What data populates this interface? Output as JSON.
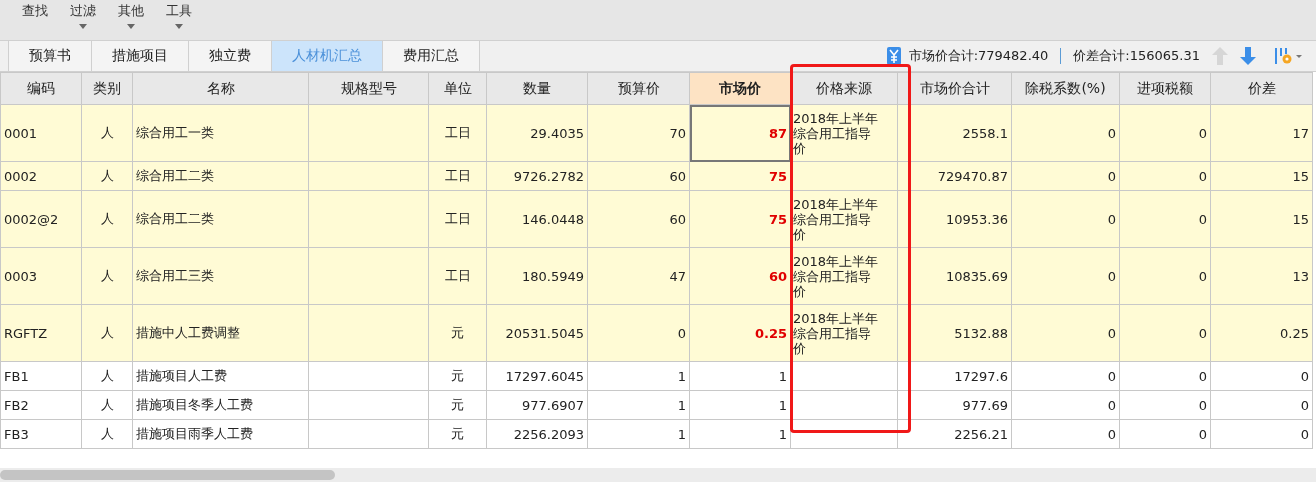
{
  "toolbar": [
    {
      "label": "查找",
      "has_menu": false
    },
    {
      "label": "过滤",
      "has_menu": true
    },
    {
      "label": "其他",
      "has_menu": true
    },
    {
      "label": "工具",
      "has_menu": true
    }
  ],
  "tabs": [
    {
      "label": "预算书",
      "selected": false
    },
    {
      "label": "措施项目",
      "selected": false
    },
    {
      "label": "独立费",
      "selected": false
    },
    {
      "label": "人材机汇总",
      "selected": true
    },
    {
      "label": "费用汇总",
      "selected": false
    }
  ],
  "summary": {
    "market_total": "市场价合计:779482.40",
    "diff_total": "价差合计:156065.31",
    "move_up_disabled": true,
    "move_down_disabled": false
  },
  "table": {
    "columns": [
      {
        "label": "编码",
        "kind": "text",
        "selected": false,
        "highlighted": false
      },
      {
        "label": "类别",
        "kind": "center",
        "selected": false,
        "highlighted": false
      },
      {
        "label": "名称",
        "kind": "text",
        "selected": false,
        "highlighted": false
      },
      {
        "label": "规格型号",
        "kind": "text",
        "selected": false,
        "highlighted": false
      },
      {
        "label": "单位",
        "kind": "center",
        "selected": false,
        "highlighted": false
      },
      {
        "label": "数量",
        "kind": "number",
        "selected": false,
        "highlighted": false
      },
      {
        "label": "预算价",
        "kind": "number",
        "selected": false,
        "highlighted": false
      },
      {
        "label": "市场价",
        "kind": "price",
        "selected": true,
        "highlighted": false
      },
      {
        "label": "价格来源",
        "kind": "wrap",
        "selected": false,
        "highlighted": true
      },
      {
        "label": "市场价合计",
        "kind": "number",
        "selected": false,
        "highlighted": false
      },
      {
        "label": "除税系数(%)",
        "kind": "number",
        "selected": false,
        "highlighted": false
      },
      {
        "label": "进项税额",
        "kind": "number",
        "selected": false,
        "highlighted": false
      },
      {
        "label": "价差",
        "kind": "number",
        "selected": false,
        "highlighted": false
      }
    ],
    "rows": [
      {
        "adjusted": true,
        "selected": true,
        "cells": [
          "0001",
          "人",
          "综合用工一类",
          null,
          "工日",
          "29.4035",
          "70",
          "87",
          "2018年上半年综合用工指导价",
          "2558.1",
          "0",
          "0",
          "17"
        ]
      },
      {
        "adjusted": true,
        "selected": false,
        "cells": [
          "0002",
          "人",
          "综合用工二类",
          null,
          "工日",
          "9726.2782",
          "60",
          "75",
          null,
          "729470.87",
          "0",
          "0",
          "15"
        ]
      },
      {
        "adjusted": true,
        "selected": false,
        "cells": [
          "0002@2",
          "人",
          "综合用工二类",
          null,
          "工日",
          "146.0448",
          "60",
          "75",
          "2018年上半年综合用工指导价",
          "10953.36",
          "0",
          "0",
          "15"
        ]
      },
      {
        "adjusted": true,
        "selected": false,
        "cells": [
          "0003",
          "人",
          "综合用工三类",
          null,
          "工日",
          "180.5949",
          "47",
          "60",
          "2018年上半年综合用工指导价",
          "10835.69",
          "0",
          "0",
          "13"
        ]
      },
      {
        "adjusted": true,
        "selected": false,
        "cells": [
          "RGFTZ",
          "人",
          "措施中人工费调整",
          null,
          "元",
          "20531.5045",
          "0",
          "0.25",
          "2018年上半年综合用工指导价",
          "5132.88",
          "0",
          "0",
          "0.25"
        ]
      },
      {
        "adjusted": false,
        "selected": false,
        "cells": [
          "FB1",
          "人",
          "措施项目人工费",
          null,
          "元",
          "17297.6045",
          "1",
          "1",
          null,
          "17297.6",
          "0",
          "0",
          "0"
        ]
      },
      {
        "adjusted": false,
        "selected": false,
        "cells": [
          "FB2",
          "人",
          "措施项目冬季人工费",
          null,
          "元",
          "977.6907",
          "1",
          "1",
          null,
          "977.69",
          "0",
          "0",
          "0"
        ]
      },
      {
        "adjusted": false,
        "selected": false,
        "cells": [
          "FB3",
          "人",
          "措施项目雨季人工费",
          null,
          "元",
          "2256.2093",
          "1",
          "1",
          null,
          "2256.21",
          "0",
          "0",
          "0"
        ]
      }
    ]
  }
}
